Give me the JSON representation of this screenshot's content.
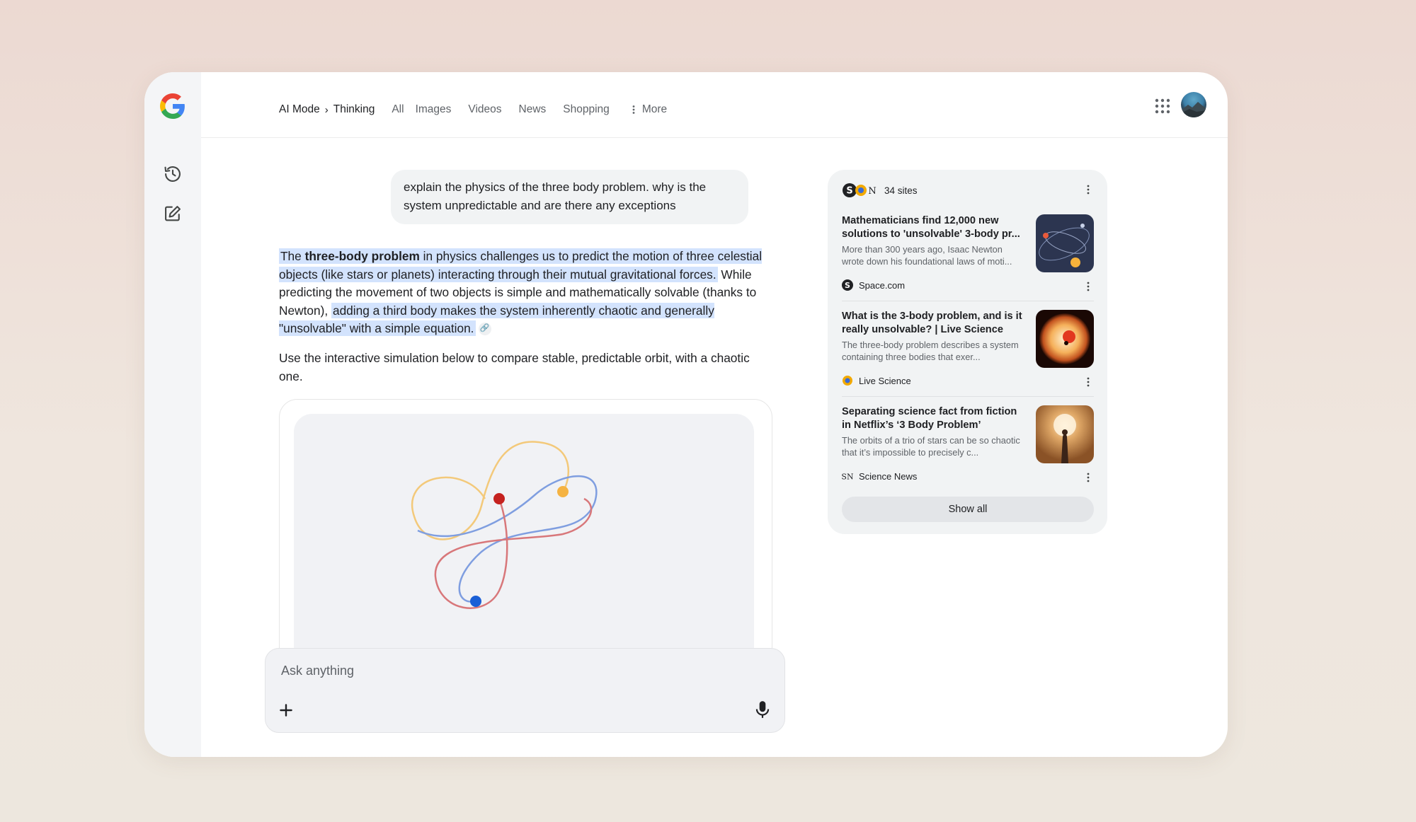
{
  "header": {
    "breadcrumb": [
      "AI Mode",
      "Thinking"
    ],
    "breadcrumb_sep": "›",
    "tabs": [
      "All",
      "Images",
      "Videos",
      "News",
      "Shopping"
    ],
    "more_label": "More"
  },
  "conversation": {
    "user_query": "explain the physics of the three body problem. why is the system unpredictable and are there any exceptions",
    "answer": {
      "p1_pre": "The ",
      "p1_bold": "three-body problem",
      "p1_hl1": " in physics challenges us to predict the motion of three celestial objects (like stars or planets) interacting through their mutual gravitational forces.",
      "p1_mid": " While predicting the movement of two objects is simple and mathematically solvable (thanks to Newton), ",
      "p1_hl2": "adding a third body makes the system inherently chaotic and generally \"unsolvable\" with a simple equation.",
      "p2": "Use the interactive simulation below to compare stable, predictable orbit, with a chaotic one."
    }
  },
  "composer": {
    "placeholder": "Ask anything"
  },
  "sources": {
    "count_label": "34 sites",
    "items": [
      {
        "title": "Mathematicians find 12,000 new solutions to 'unsolvable' 3-body pr...",
        "snippet": "More than 300 years ago, Isaac Newton wrote down his foundational laws of moti...",
        "site": "Space.com"
      },
      {
        "title": "What is the 3-body problem, and is it really unsolvable? | Live Science",
        "snippet": "The three-body problem describes a system containing three bodies that exer...",
        "site": "Live Science"
      },
      {
        "title": "Separating science fact from fiction in Netflix’s ‘3 Body Problem’",
        "snippet": "The orbits of a trio of stars can be so chaotic that it’s impossible to precisely c...",
        "site": "Science News"
      }
    ],
    "show_all_label": "Show all"
  },
  "colors": {
    "accent_highlight": "#d3e3fd",
    "orbit_red": "#c5221f",
    "orbit_yellow": "#f5b342",
    "orbit_blue": "#1a5fd6"
  }
}
